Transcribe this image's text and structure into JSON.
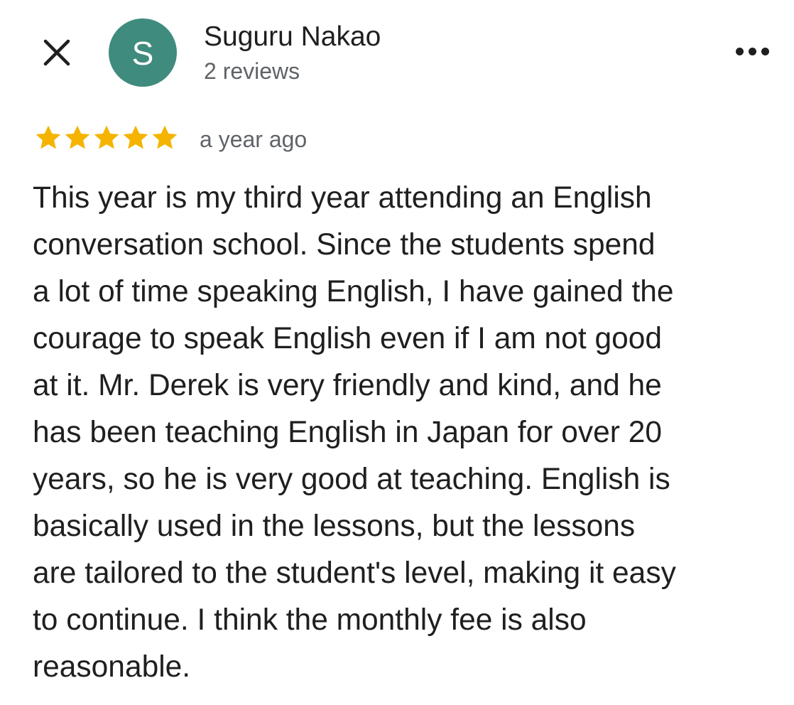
{
  "header": {
    "reviewer_name": "Suguru Nakao",
    "review_count": "2 reviews",
    "avatar_initial": "S",
    "avatar_color": "#3f8b7e",
    "close_icon": "close-icon",
    "more_icon": "more-horizontal-icon"
  },
  "review": {
    "rating": 5,
    "rating_max": 5,
    "star_color": "#f4b400",
    "time_ago": "a year ago",
    "lines": [
      "This year is my third year attending an English",
      "conversation school. Since the students spend",
      "a lot of time speaking English, I have gained the",
      "courage to speak English even if I am not good",
      "at it. Mr. Derek is very friendly and kind, and he",
      "has been teaching English in Japan for over 20",
      "years, so he is very good at teaching. English is",
      "basically used in the lessons, but the lessons",
      "are tailored to the student's level, making it easy",
      "to continue. I think the monthly fee is also",
      "reasonable."
    ]
  }
}
